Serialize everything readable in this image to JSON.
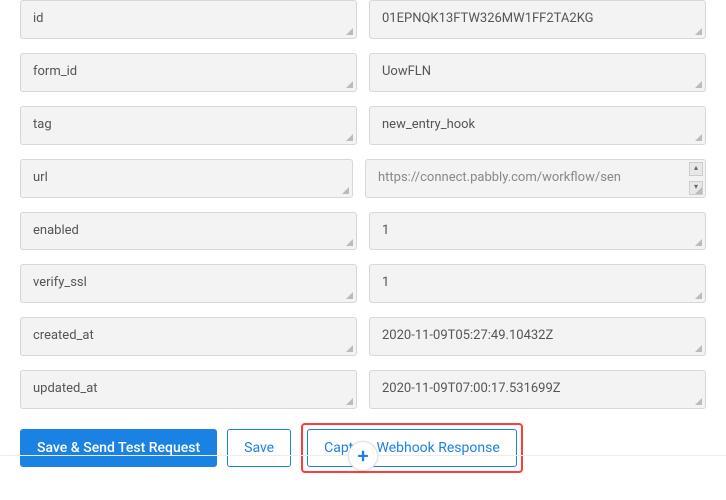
{
  "fields": [
    {
      "key": "id",
      "value": "01EPNQK13FTW326MW1FF2TA2KG"
    },
    {
      "key": "form_id",
      "value": "UowFLN"
    },
    {
      "key": "tag",
      "value": "new_entry_hook"
    },
    {
      "key": "url",
      "value": "https://connect.pabbly.com/workflow/sen"
    },
    {
      "key": "enabled",
      "value": "1"
    },
    {
      "key": "verify_ssl",
      "value": "1"
    },
    {
      "key": "created_at",
      "value": "2020-11-09T05:27:49.10432Z"
    },
    {
      "key": "updated_at",
      "value": "2020-11-09T07:00:17.531699Z"
    }
  ],
  "buttons": {
    "save_send": "Save & Send Test Request",
    "save": "Save",
    "capture": "Capture Webhook Response"
  },
  "add_label": "+"
}
